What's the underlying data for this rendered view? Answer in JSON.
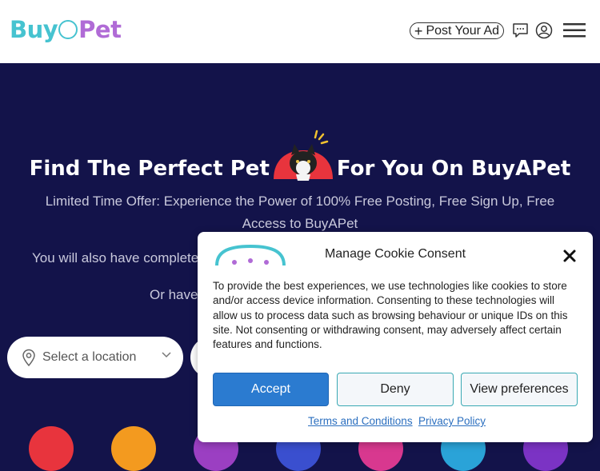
{
  "header": {
    "logo": {
      "part1": "Buy",
      "part2": "Pet"
    },
    "post_ad_label": "Post Your Ad",
    "icons": [
      "chat-icon",
      "user-icon",
      "menu-icon"
    ]
  },
  "hero": {
    "title_left": "Find The Perfect Pet",
    "title_right": "For You On BuyAPet",
    "subtitle": "Limited Time Offer: Experience the Power of 100% Free Posting, Free Sign Up, Free Access to BuyAPet",
    "line2": "You will also have complete ac",
    "line3": "Or  have"
  },
  "search": {
    "location_placeholder": "Select a location"
  },
  "cookie_banner": {
    "title": "Manage Cookie Consent",
    "body": "To provide the best experiences, we use technologies like cookies to store and/or access device information. Consenting to these technologies will allow us to process data such as browsing behaviour or unique IDs on this site. Not consenting or withdrawing consent, may adversely affect certain features and functions.",
    "accept_label": "Accept",
    "deny_label": "Deny",
    "preferences_label": "View preferences",
    "terms_label": "Terms and Conditions",
    "privacy_label": "Privacy Policy"
  },
  "categories": [
    {
      "icon": "dog-icon",
      "color": "#e8343d"
    },
    {
      "icon": "cat-icon",
      "color": "#f39a1f"
    },
    {
      "icon": "bird-icon",
      "color": "#9b3fc2"
    },
    {
      "icon": "horse-icon",
      "color": "#3a4fcf"
    },
    {
      "icon": "fish-icon",
      "color": "#d8388f"
    },
    {
      "icon": "reptile-icon",
      "color": "#2aa3d8"
    },
    {
      "icon": "small-pet-icon",
      "color": "#7b33c4"
    }
  ],
  "colors": {
    "hero_bg": "#13134a",
    "brand_teal": "#46c3d0",
    "brand_purple": "#b06bd6",
    "accept_blue": "#2b7bd0"
  }
}
